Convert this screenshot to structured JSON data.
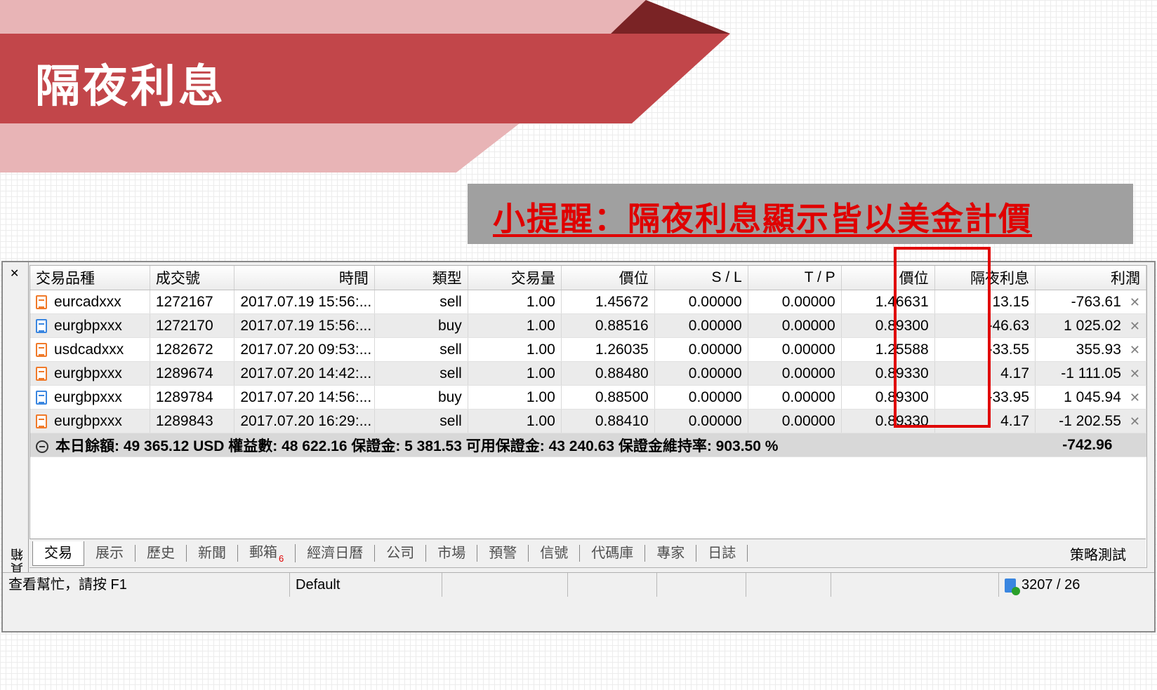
{
  "banner": {
    "title": "隔夜利息"
  },
  "tip": {
    "text": "小提醒：隔夜利息顯示皆以美金計價"
  },
  "terminal": {
    "side_label": "工具箱",
    "columns": [
      "交易品種",
      "成交號",
      "時間",
      "類型",
      "交易量",
      "價位",
      "S / L",
      "T / P",
      "價位",
      "隔夜利息",
      "利潤"
    ],
    "rows": [
      {
        "symbol": "eurcadxxx",
        "ticket": "1272167",
        "time": "2017.07.19 15:56:...",
        "type": "sell",
        "volume": "1.00",
        "open_price": "1.45672",
        "sl": "0.00000",
        "tp": "0.00000",
        "price": "1.46631",
        "swap": "13.15",
        "profit": "-763.61"
      },
      {
        "symbol": "eurgbpxxx",
        "ticket": "1272170",
        "time": "2017.07.19 15:56:...",
        "type": "buy",
        "volume": "1.00",
        "open_price": "0.88516",
        "sl": "0.00000",
        "tp": "0.00000",
        "price": "0.89300",
        "swap": "-46.63",
        "profit": "1 025.02"
      },
      {
        "symbol": "usdcadxxx",
        "ticket": "1282672",
        "time": "2017.07.20 09:53:...",
        "type": "sell",
        "volume": "1.00",
        "open_price": "1.26035",
        "sl": "0.00000",
        "tp": "0.00000",
        "price": "1.25588",
        "swap": "-33.55",
        "profit": "355.93"
      },
      {
        "symbol": "eurgbpxxx",
        "ticket": "1289674",
        "time": "2017.07.20 14:42:...",
        "type": "sell",
        "volume": "1.00",
        "open_price": "0.88480",
        "sl": "0.00000",
        "tp": "0.00000",
        "price": "0.89330",
        "swap": "4.17",
        "profit": "-1 111.05"
      },
      {
        "symbol": "eurgbpxxx",
        "ticket": "1289784",
        "time": "2017.07.20 14:56:...",
        "type": "buy",
        "volume": "1.00",
        "open_price": "0.88500",
        "sl": "0.00000",
        "tp": "0.00000",
        "price": "0.89300",
        "swap": "-33.95",
        "profit": "1 045.94"
      },
      {
        "symbol": "eurgbpxxx",
        "ticket": "1289843",
        "time": "2017.07.20 16:29:...",
        "type": "sell",
        "volume": "1.00",
        "open_price": "0.88410",
        "sl": "0.00000",
        "tp": "0.00000",
        "price": "0.89330",
        "swap": "4.17",
        "profit": "-1 202.55"
      }
    ],
    "summary": {
      "text": "本日餘額: 49 365.12 USD  權益數: 48 622.16  保證金: 5 381.53  可用保證金: 43 240.63  保證金維持率: 903.50 %",
      "total": "-742.96"
    },
    "tabs": [
      "交易",
      "展示",
      "歷史",
      "新聞",
      "郵箱",
      "經濟日曆",
      "公司",
      "市場",
      "預警",
      "信號",
      "代碼庫",
      "專家",
      "日誌"
    ],
    "mail_badge": "6",
    "right_tab": "策略測試",
    "status": {
      "help": "查看幫忙，請按 F1",
      "profile": "Default",
      "traffic": "3207 / 26"
    }
  },
  "colors": {
    "banner_dark": "#c2464a",
    "banner_light": "#e8b4b6",
    "banner_shadow": "#8b2a2c",
    "tip_bg": "#a0a0a0",
    "tip_text": "#e00000",
    "highlight": "#e00000"
  }
}
